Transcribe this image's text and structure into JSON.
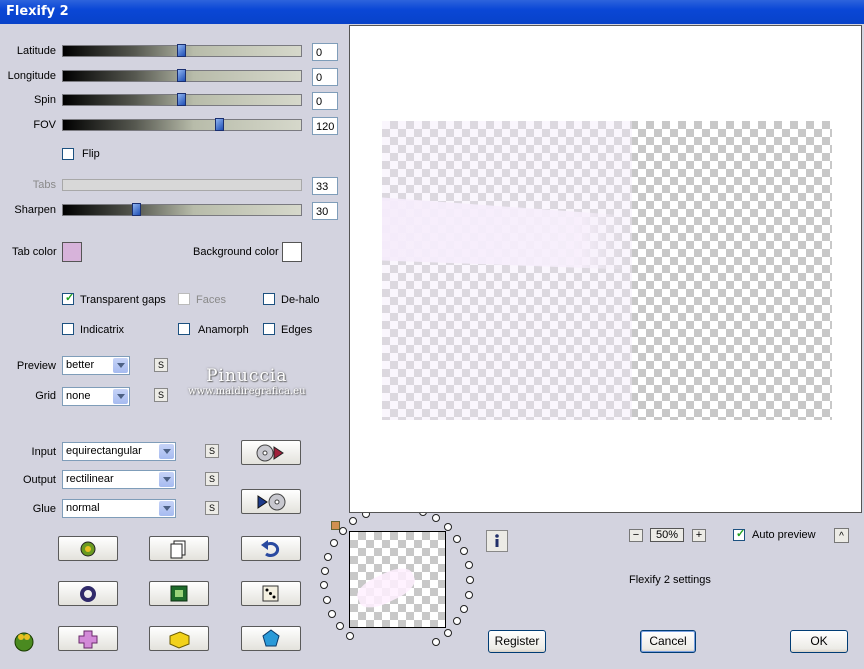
{
  "window": {
    "title": "Flexify 2"
  },
  "sliders": {
    "latitude": {
      "label": "Latitude",
      "value": "0",
      "fraction": 0.5
    },
    "longitude": {
      "label": "Longitude",
      "value": "0",
      "fraction": 0.5
    },
    "spin": {
      "label": "Spin",
      "value": "0",
      "fraction": 0.5
    },
    "fov": {
      "label": "FOV",
      "value": "120",
      "fraction": 0.66
    },
    "tabs": {
      "label": "Tabs",
      "value": "33"
    },
    "sharpen": {
      "label": "Sharpen",
      "value": "30",
      "fraction": 0.31
    }
  },
  "checkboxes": {
    "flip": {
      "label": "Flip",
      "checked": false
    },
    "transparent_gaps": {
      "label": "Transparent gaps",
      "checked": true
    },
    "faces": {
      "label": "Faces",
      "checked": false,
      "disabled": true
    },
    "dehalo": {
      "label": "De-halo",
      "checked": false
    },
    "indicatrix": {
      "label": "Indicatrix",
      "checked": false
    },
    "anamorph": {
      "label": "Anamorph",
      "checked": false
    },
    "edges": {
      "label": "Edges",
      "checked": false
    },
    "auto_preview": {
      "label": "Auto preview",
      "checked": true
    }
  },
  "colors": {
    "tab_color_label": "Tab color",
    "tab_color": "#d7b3da",
    "background_color_label": "Background color",
    "background_color": "#ffffff"
  },
  "selects": {
    "preview": {
      "label": "Preview",
      "value": "better"
    },
    "grid": {
      "label": "Grid",
      "value": "none"
    },
    "input": {
      "label": "Input",
      "value": "equirectangular"
    },
    "output": {
      "label": "Output",
      "value": "rectilinear"
    },
    "glue": {
      "label": "Glue",
      "value": "normal"
    }
  },
  "watermark": {
    "name": "Pinuccia",
    "url": "www.maidiregrafica.eu"
  },
  "small_button_label": "S",
  "zoom": {
    "minus": "−",
    "value": "50%",
    "plus": "+"
  },
  "collapse_button": "^",
  "settings_text": "Flexify 2 settings",
  "buttons": {
    "register": "Register",
    "cancel": "Cancel",
    "ok": "OK"
  }
}
